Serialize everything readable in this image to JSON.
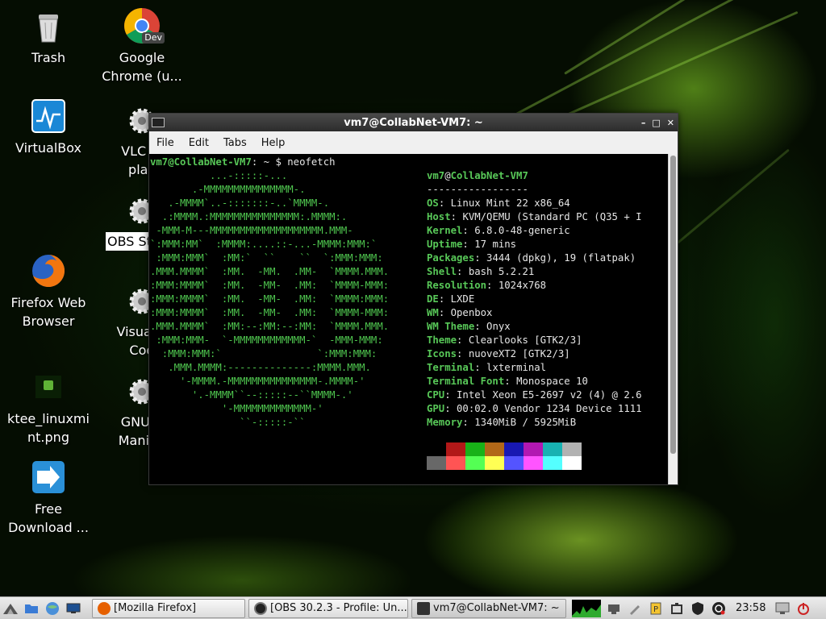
{
  "desktop": {
    "icons": [
      {
        "label": "Trash"
      },
      {
        "label": "Google\nChrome (u..."
      },
      {
        "label": "VirtualBox"
      },
      {
        "label": "VLC m\nplay"
      },
      {
        "label": "OBS St"
      },
      {
        "label": "Firefox Web\nBrowser"
      },
      {
        "label": "Visual S\nCod"
      },
      {
        "label": "ktee_linuxmi\nnt.png"
      },
      {
        "label": "GNU Ir\nManipu"
      },
      {
        "label": "Free\nDownload ..."
      }
    ],
    "chrome_badge": "Dev"
  },
  "terminal": {
    "title": "vm7@CollabNet-VM7: ~",
    "window_buttons": [
      "–",
      "□",
      "✕"
    ],
    "menu": [
      "File",
      "Edit",
      "Tabs",
      "Help"
    ],
    "prompt_user": "vm7@CollabNet-VM7",
    "prompt_suffix": ": ~ $ ",
    "command": "neofetch",
    "logo": [
      "          ...-:::::-...",
      "       .-MMMMMMMMMMMMMMM-.",
      "   .-MMMM`..-:::::::-..`MMMM-.",
      "  .:MMMM.:MMMMMMMMMMMMMMM:.MMMM:.",
      " -MMM-M---MMMMMMMMMMMMMMMMMMM.MMM-",
      "`:MMM:MM`  :MMMM:....::-...-MMMM:MMM:`",
      " :MMM:MMM`  :MM:`  ``    ``  `:MMM:MMM:",
      ".MMM.MMMM`  :MM.  -MM.  .MM-  `MMMM.MMM.",
      ":MMM:MMMM`  :MM.  -MM-  .MM:  `MMMM-MMM:",
      ":MMM:MMMM`  :MM.  -MM-  .MM:  `MMMM:MMM:",
      ":MMM:MMMM`  :MM.  -MM-  .MM:  `MMMM-MMM:",
      ".MMM.MMMM`  :MM:--:MM:--:MM:  `MMMM.MMM.",
      " :MMM:MMM-  `-MMMMMMMMMMMM-`  -MMM-MMM:",
      "  :MMM:MMM:`                `:MMM:MMM:",
      "   .MMM.MMMM:--------------:MMMM.MMM.",
      "     '-MMMM.-MMMMMMMMMMMMMMM-.MMMM-'",
      "       '.-MMMM``--:::::--``MMMM-.'",
      "            '-MMMMMMMMMMMMM-'",
      "               ``-:::::-``"
    ],
    "info_user": "vm7",
    "info_at": "@",
    "info_host": "CollabNet-VM7",
    "separator": "-----------------",
    "info": [
      {
        "key": "OS",
        "value": "Linux Mint 22 x86_64"
      },
      {
        "key": "Host",
        "value": "KVM/QEMU (Standard PC (Q35 + I"
      },
      {
        "key": "Kernel",
        "value": "6.8.0-48-generic"
      },
      {
        "key": "Uptime",
        "value": "17 mins"
      },
      {
        "key": "Packages",
        "value": "3444 (dpkg), 19 (flatpak)"
      },
      {
        "key": "Shell",
        "value": "bash 5.2.21"
      },
      {
        "key": "Resolution",
        "value": "1024x768"
      },
      {
        "key": "DE",
        "value": "LXDE"
      },
      {
        "key": "WM",
        "value": "Openbox"
      },
      {
        "key": "WM Theme",
        "value": "Onyx"
      },
      {
        "key": "Theme",
        "value": "Clearlooks [GTK2/3]"
      },
      {
        "key": "Icons",
        "value": "nuoveXT2 [GTK2/3]"
      },
      {
        "key": "Terminal",
        "value": "lxterminal"
      },
      {
        "key": "Terminal Font",
        "value": "Monospace 10"
      },
      {
        "key": "CPU",
        "value": "Intel Xeon E5-2697 v2 (4) @ 2.6"
      },
      {
        "key": "GPU",
        "value": "00:02.0 Vendor 1234 Device 1111"
      },
      {
        "key": "Memory",
        "value": "1340MiB / 5925MiB"
      }
    ],
    "colors_row1": [
      "#000000",
      "#b21818",
      "#18b218",
      "#b26818",
      "#1818b2",
      "#b218b2",
      "#18b2b2",
      "#b2b2b2"
    ],
    "colors_row2": [
      "#686868",
      "#ff5454",
      "#54ff54",
      "#ffff54",
      "#5454ff",
      "#ff54ff",
      "#54ffff",
      "#ffffff"
    ]
  },
  "taskbar": {
    "tasks": [
      {
        "label": "[Mozilla Firefox]",
        "color": "#e66000"
      },
      {
        "label": "[OBS 30.2.3 - Profile: Un...",
        "color": "#222222"
      },
      {
        "label": "vm7@CollabNet-VM7: ~",
        "color": "#333333"
      }
    ],
    "clock": "23:58"
  }
}
